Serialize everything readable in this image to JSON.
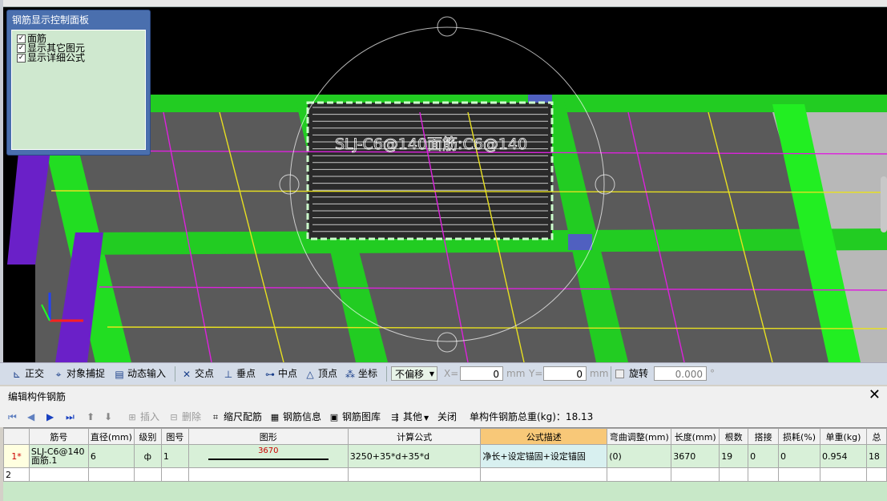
{
  "viewport": {
    "label": "SLJ-C6@140面筋:C6@140",
    "colors": {
      "green": "#22dd22",
      "slab": "#5a5a5a",
      "magenta": "#dd22dd",
      "yellow": "#e8e020",
      "purple": "#6a20c8"
    }
  },
  "panel": {
    "title": "钢筋显示控制面板",
    "options": [
      {
        "label": "面筋",
        "checked": true
      },
      {
        "label": "显示其它图元",
        "checked": true
      },
      {
        "label": "显示详细公式",
        "checked": true
      }
    ]
  },
  "statusbar": {
    "ortho": "正交",
    "snap": "对象捕捉",
    "dyn": "动态输入",
    "intersect": "交点",
    "perp": "垂点",
    "mid": "中点",
    "vertex": "顶点",
    "coord": "坐标",
    "offset": "不偏移",
    "x_label": "X=",
    "x_value": "0",
    "mm1": "mm",
    "y_label": "Y=",
    "y_value": "0",
    "mm2": "mm",
    "rotate": "旋转",
    "rotate_value": "0.000",
    "deg": "°"
  },
  "editor": {
    "title": "编辑构件钢筋",
    "close_icon": "close-icon",
    "toolbar": {
      "insert": "插入",
      "delete": "删除",
      "scale": "缩尺配筋",
      "info": "钢筋信息",
      "library": "钢筋图库",
      "other": "其他",
      "close": "关闭",
      "total": "单构件钢筋总重(kg)：18.13"
    },
    "columns": [
      "筋号",
      "直径(mm)",
      "级别",
      "图号",
      "图形",
      "计算公式",
      "公式描述",
      "弯曲调整(mm)",
      "长度(mm)",
      "根数",
      "搭接",
      "损耗(%)",
      "单重(kg)",
      "总"
    ],
    "rows": [
      {
        "rownum": "1*",
        "name1": "SLJ-C6@140",
        "name2": "面筋.1",
        "dia": "6",
        "grade": "ф",
        "fig": "1",
        "shape": "3670",
        "formula": "3250+35*d+35*d",
        "desc": "净长+设定锚固+设定锚固",
        "bend": "(0)",
        "length": "3670",
        "count": "19",
        "lap": "0",
        "loss": "0",
        "unit": "0.954",
        "total": "18"
      },
      {
        "rownum": "2"
      }
    ]
  }
}
